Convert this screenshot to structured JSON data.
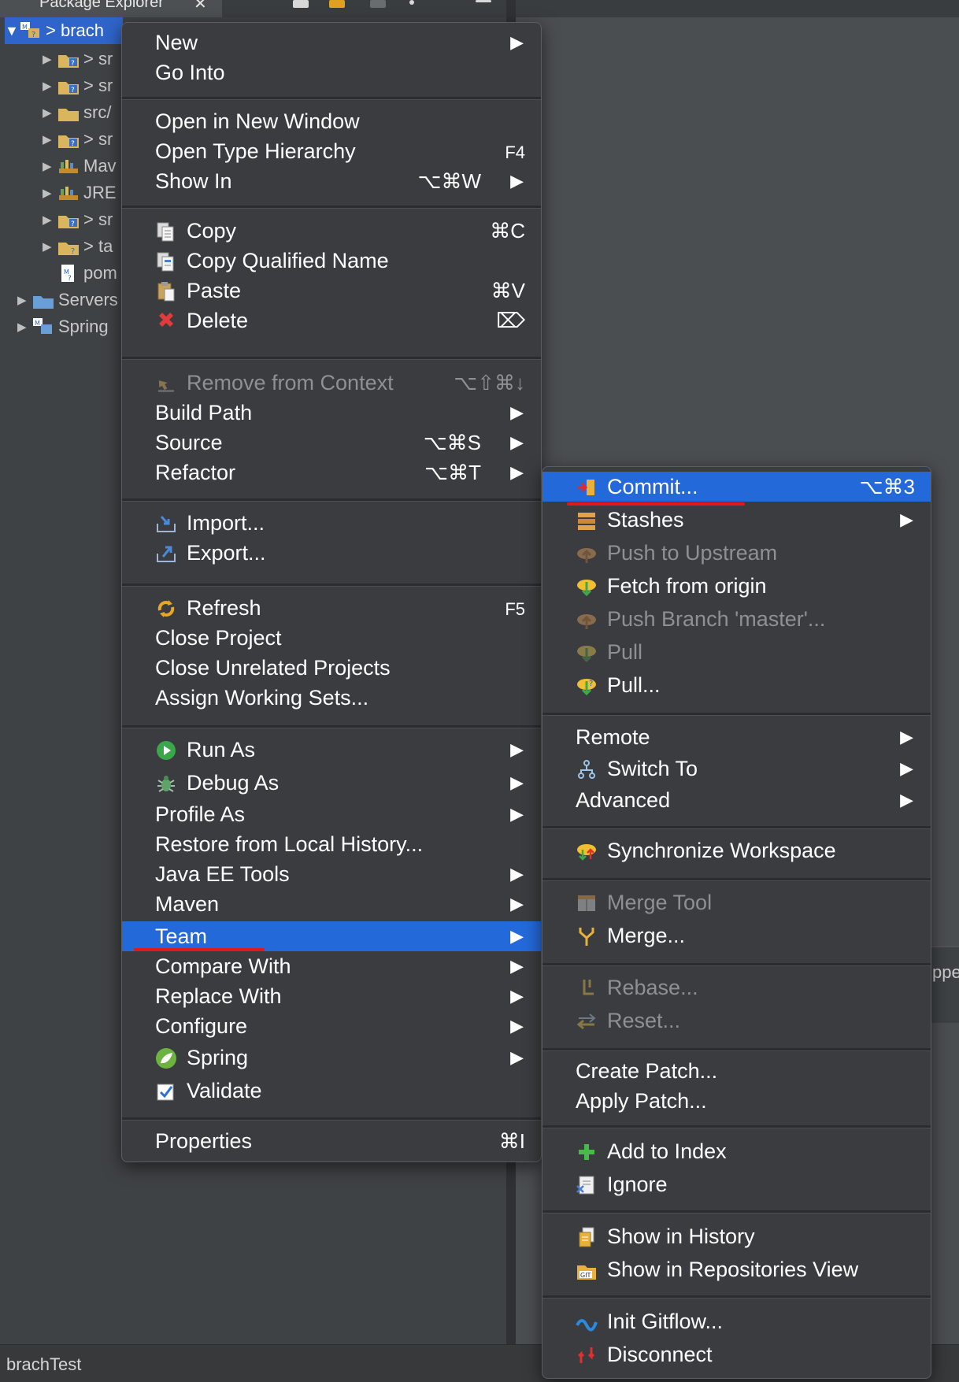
{
  "window": {
    "tab_label": "Package Explorer",
    "tab_close": "✕",
    "status_text": "brachTest",
    "right_edge_text": "ppe"
  },
  "tree": [
    {
      "label": "> brach",
      "expanded": true,
      "selected": true
    },
    {
      "label": "> sr"
    },
    {
      "label": "> sr"
    },
    {
      "label": "src/"
    },
    {
      "label": "> sr"
    },
    {
      "label": "Mav"
    },
    {
      "label": "JRE"
    },
    {
      "label": "> sr"
    },
    {
      "label": "> ta"
    },
    {
      "label": "pom"
    },
    {
      "label": "Servers"
    },
    {
      "label": "Spring"
    }
  ],
  "main_menu": {
    "new": "New",
    "go_into": "Go Into",
    "open_new_window": "Open in New Window",
    "open_type_hierarchy": "Open Type Hierarchy",
    "open_type_hierarchy_sc": "F4",
    "show_in": "Show In",
    "show_in_sc": "⌥⌘W",
    "copy": "Copy",
    "copy_sc": "⌘C",
    "copy_qualified": "Copy Qualified Name",
    "paste": "Paste",
    "paste_sc": "⌘V",
    "delete": "Delete",
    "delete_sc": "⌦",
    "remove_context": "Remove from Context",
    "remove_context_sc": "⌥⇧⌘↓",
    "build_path": "Build Path",
    "source": "Source",
    "source_sc": "⌥⌘S",
    "refactor": "Refactor",
    "refactor_sc": "⌥⌘T",
    "import": "Import...",
    "export": "Export...",
    "refresh": "Refresh",
    "refresh_sc": "F5",
    "close_project": "Close Project",
    "close_unrelated": "Close Unrelated Projects",
    "assign_working_sets": "Assign Working Sets...",
    "run_as": "Run As",
    "debug_as": "Debug As",
    "profile_as": "Profile As",
    "restore_history": "Restore from Local History...",
    "java_ee_tools": "Java EE Tools",
    "maven": "Maven",
    "team": "Team",
    "compare_with": "Compare With",
    "replace_with": "Replace With",
    "configure": "Configure",
    "spring": "Spring",
    "validate": "Validate",
    "properties": "Properties",
    "properties_sc": "⌘I"
  },
  "team_menu": {
    "commit": "Commit...",
    "commit_sc": "⌥⌘3",
    "stashes": "Stashes",
    "push_upstream": "Push to Upstream",
    "fetch_origin": "Fetch from origin",
    "push_branch": "Push Branch 'master'...",
    "pull": "Pull",
    "pull_dots": "Pull...",
    "remote": "Remote",
    "switch_to": "Switch To",
    "advanced": "Advanced",
    "synchronize": "Synchronize Workspace",
    "merge_tool": "Merge Tool",
    "merge": "Merge...",
    "rebase": "Rebase...",
    "reset": "Reset...",
    "create_patch": "Create Patch...",
    "apply_patch": "Apply Patch...",
    "add_to_index": "Add to Index",
    "ignore": "Ignore",
    "show_history": "Show in History",
    "show_repositories": "Show in Repositories View",
    "init_gitflow": "Init Gitflow...",
    "disconnect": "Disconnect"
  },
  "submenu_arrow": "▶",
  "tree_arrow_collapsed": "▶",
  "tree_arrow_expanded": "▼",
  "colors": {
    "highlight": "#2469d9",
    "menu_bg": "#3a3c3f",
    "annotation_underline": "#e0191b",
    "disabled_text": "#8e9093"
  }
}
